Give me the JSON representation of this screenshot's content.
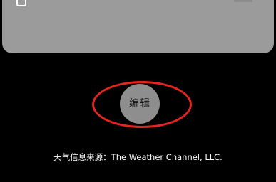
{
  "widget": {
    "icon": "phone-icon"
  },
  "edit_button": {
    "label": "编辑"
  },
  "annotation": {
    "highlight_color": "#e4251f"
  },
  "attribution": {
    "link_text": "天气",
    "text": "信息来源：The Weather Channel, LLC."
  }
}
